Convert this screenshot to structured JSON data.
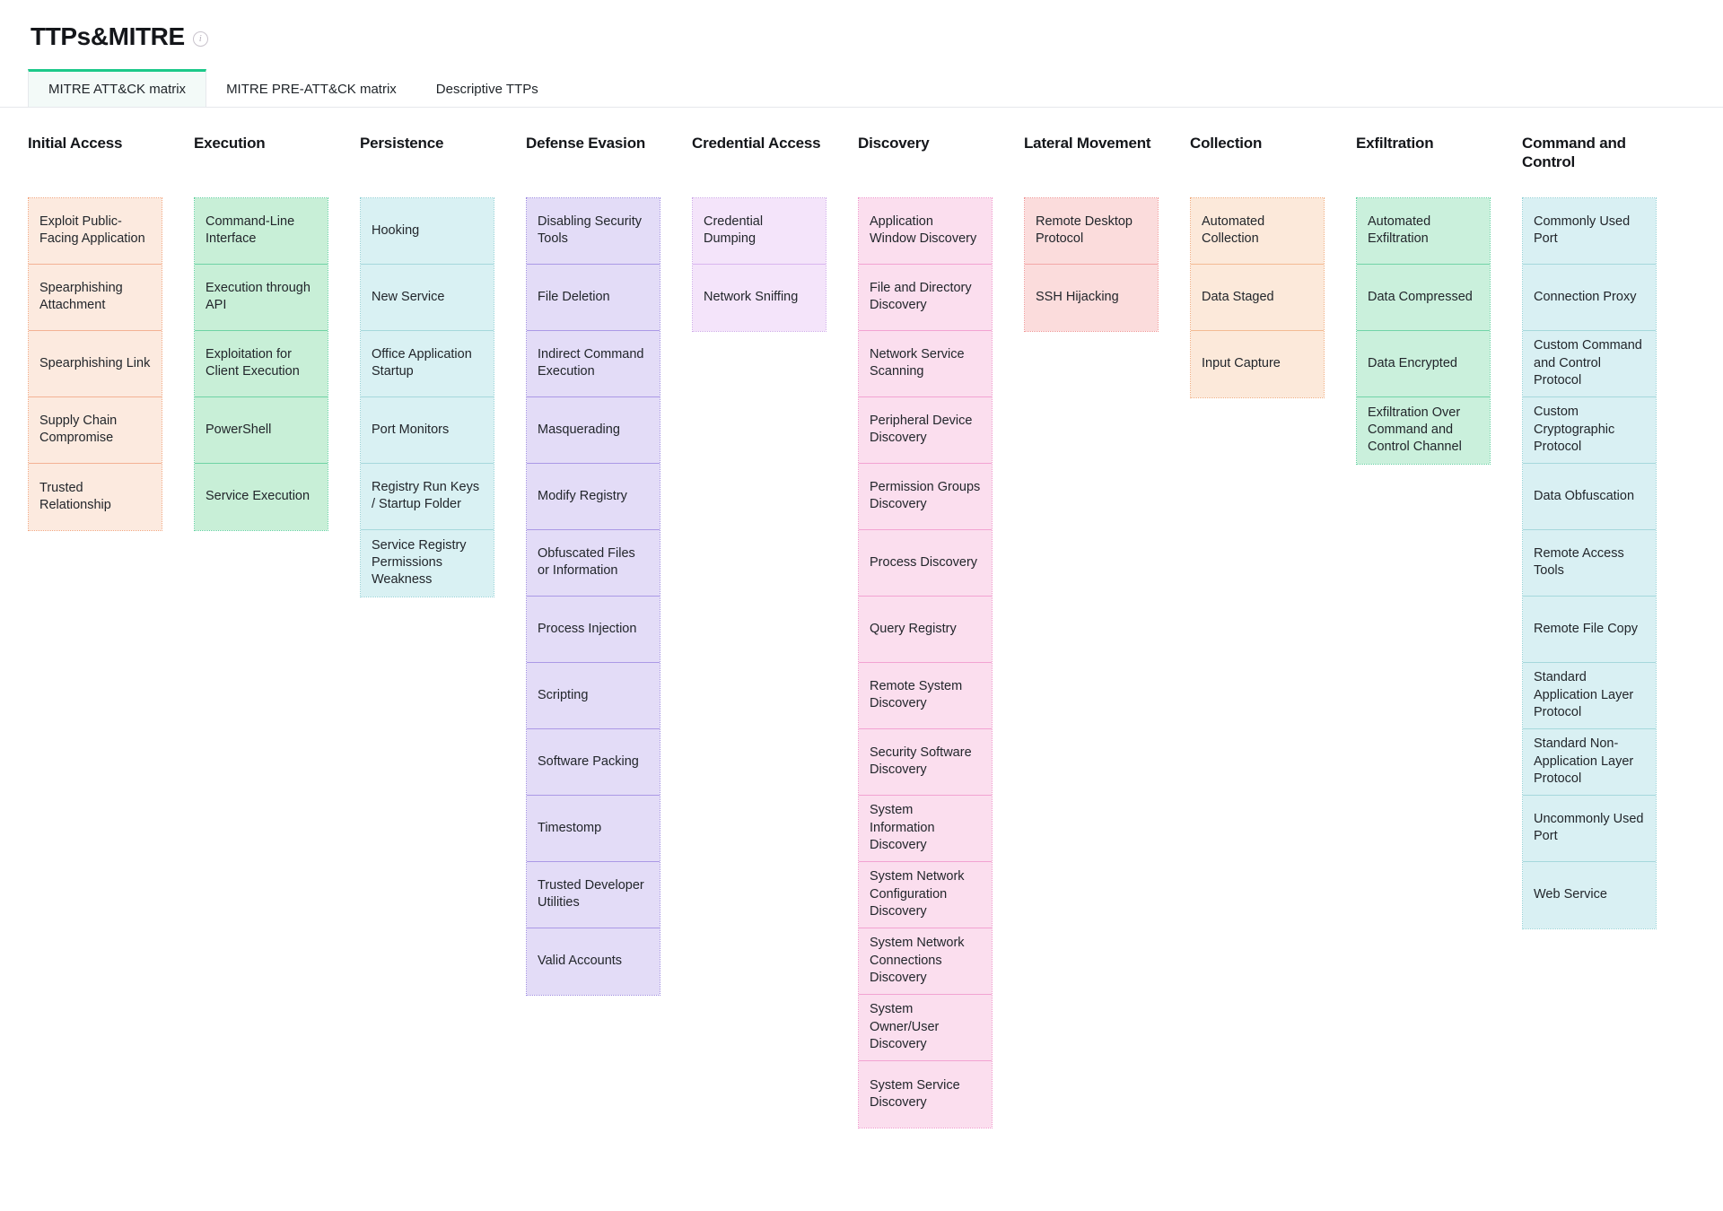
{
  "header": {
    "title": "TTPs&MITRE",
    "info_icon": "info-circle-icon"
  },
  "tabs": [
    {
      "label": "MITRE ATT&CK matrix",
      "active": true
    },
    {
      "label": "MITRE PRE-ATT&CK matrix",
      "active": false
    },
    {
      "label": "Descriptive TTPs",
      "active": false
    }
  ],
  "matrix": {
    "columns": [
      {
        "title": "Initial Access",
        "theme": "c-peach",
        "accent": "#f3b294",
        "items": [
          "Exploit Public-Facing Application",
          "Spearphishing Attachment",
          "Spearphishing Link",
          "Supply Chain Compromise",
          "Trusted Relationship"
        ]
      },
      {
        "title": "Execution",
        "theme": "c-green",
        "accent": "#6fd3a5",
        "items": [
          "Command-Line Interface",
          "Execution through API",
          "Exploitation for Client Execution",
          "PowerShell",
          "Service Execution"
        ]
      },
      {
        "title": "Persistence",
        "theme": "c-cyan",
        "accent": "#a6d8dc",
        "items": [
          "Hooking",
          "New Service",
          "Office Application Startup",
          "Port Monitors",
          "Registry Run Keys / Startup Folder",
          "Service Registry Permissions Weakness"
        ]
      },
      {
        "title": "Defense Evasion",
        "theme": "c-purple",
        "accent": "#ab99e6",
        "items": [
          "Disabling Security Tools",
          "File Deletion",
          "Indirect Command Execution",
          "Masquerading",
          "Modify Registry",
          "Obfuscated Files or Information",
          "Process Injection",
          "Scripting",
          "Software Packing",
          "Timestomp",
          "Trusted Developer Utilities",
          "Valid Accounts"
        ]
      },
      {
        "title": "Credential Access",
        "theme": "c-violet",
        "accent": "#d9b6ee",
        "items": [
          "Credential Dumping",
          "Network Sniffing"
        ]
      },
      {
        "title": "Discovery",
        "theme": "c-pink",
        "accent": "#f2a3d2",
        "items": [
          "Application Window Discovery",
          "File and Directory Discovery",
          "Network Service Scanning",
          "Peripheral Device Discovery",
          "Permission Groups Discovery",
          "Process Discovery",
          "Query Registry",
          "Remote System Discovery",
          "Security Software Discovery",
          "System Information Discovery",
          "System Network Configuration Discovery",
          "System Network Connections Discovery",
          "System Owner/User Discovery",
          "System Service Discovery"
        ]
      },
      {
        "title": "Lateral Movement",
        "theme": "c-rose",
        "accent": "#f3a7a7",
        "items": [
          "Remote Desktop Protocol",
          "SSH Hijacking"
        ]
      },
      {
        "title": "Collection",
        "theme": "c-sand",
        "accent": "#f3bb94",
        "items": [
          "Automated Collection",
          "Data Staged",
          "Input Capture"
        ]
      },
      {
        "title": "Exfiltration",
        "theme": "c-mint",
        "accent": "#72d4a8",
        "items": [
          "Automated Exfiltration",
          "Data Compressed",
          "Data Encrypted",
          "Exfiltration Over Command and Control Channel"
        ]
      },
      {
        "title": "Command and Control",
        "theme": "c-sky",
        "accent": "#a6d8dc",
        "items": [
          "Commonly Used Port",
          "Connection Proxy",
          "Custom Command and Control Protocol",
          "Custom Cryptographic Protocol",
          "Data Obfuscation",
          "Remote Access Tools",
          "Remote File Copy",
          "Standard Application Layer Protocol",
          "Standard Non-Application Layer Protocol",
          "Uncommonly Used Port",
          "Web Service"
        ]
      }
    ]
  },
  "colors": {
    "active_tab_underline": "#1cc98a",
    "active_tab_bg": "#f3faf8",
    "text": "#14161a",
    "divider": "#e6e8ec"
  }
}
